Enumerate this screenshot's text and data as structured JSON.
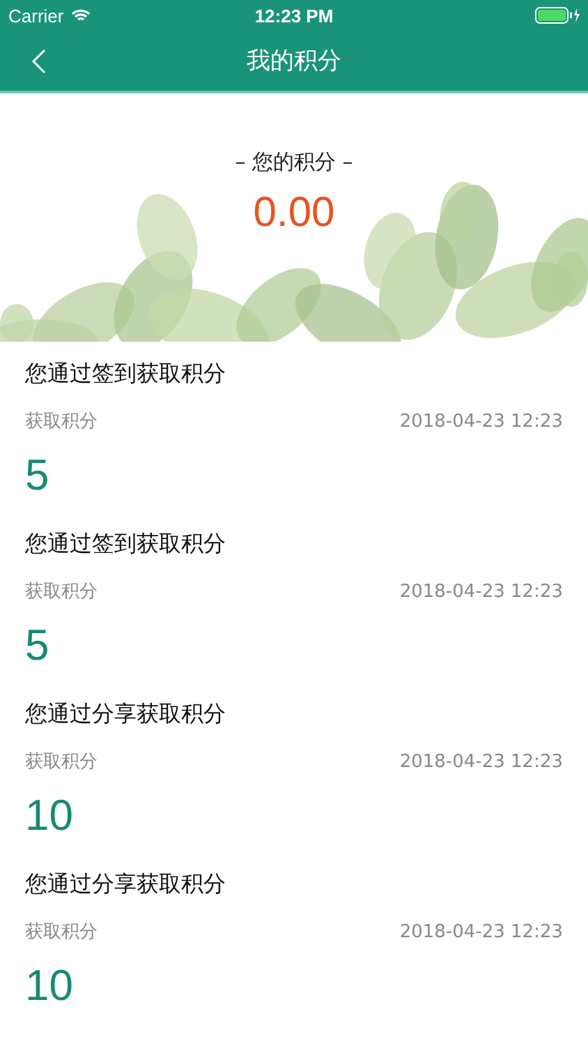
{
  "status_bar": {
    "carrier": "Carrier",
    "time": "12:23 PM"
  },
  "nav": {
    "title": "我的积分"
  },
  "summary": {
    "label": "– 您的积分 –",
    "points": "0.00"
  },
  "records": [
    {
      "title": "您通过签到获取积分",
      "label": "获取积分",
      "time": "2018-04-23 12:23",
      "points": "5"
    },
    {
      "title": "您通过签到获取积分",
      "label": "获取积分",
      "time": "2018-04-23 12:23",
      "points": "5"
    },
    {
      "title": "您通过分享获取积分",
      "label": "获取积分",
      "time": "2018-04-23 12:23",
      "points": "10"
    },
    {
      "title": "您通过分享获取积分",
      "label": "获取积分",
      "time": "2018-04-23 12:23",
      "points": "10"
    }
  ]
}
